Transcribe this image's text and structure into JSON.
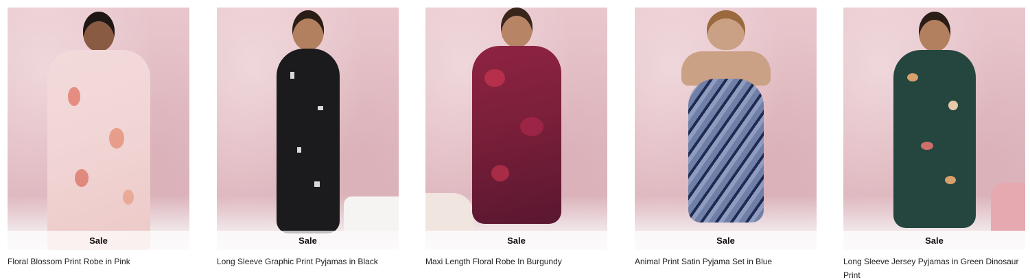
{
  "products": [
    {
      "badge": "Sale",
      "title": "Floral Blossom Print Robe in Pink",
      "colors": {
        "garment": "#f1d6d6",
        "accent": "#e07a6a",
        "hair": "#1f1714"
      }
    },
    {
      "badge": "Sale",
      "title": "Long Sleeve Graphic Print Pyjamas in Black",
      "colors": {
        "garment": "#1b1a1c",
        "accent": "#d9d9d9",
        "hair": "#2a1d17"
      }
    },
    {
      "badge": "Sale",
      "title": "Maxi Length Floral Robe In Burgundy",
      "colors": {
        "garment": "#7a1f3a",
        "accent": "#c2334f",
        "hair": "#3a251b"
      }
    },
    {
      "badge": "Sale",
      "title": "Animal Print Satin Pyjama Set in Blue",
      "colors": {
        "garment": "#6f7fa8",
        "accent": "#1e2a52",
        "hair": "#9a6a3e"
      }
    },
    {
      "badge": "Sale",
      "title": "Long Sleeve Jersey Pyjamas in Green Dinosaur Print",
      "colors": {
        "garment": "#24463f",
        "accent": "#d8a06a",
        "hair": "#2a1d17"
      }
    }
  ]
}
